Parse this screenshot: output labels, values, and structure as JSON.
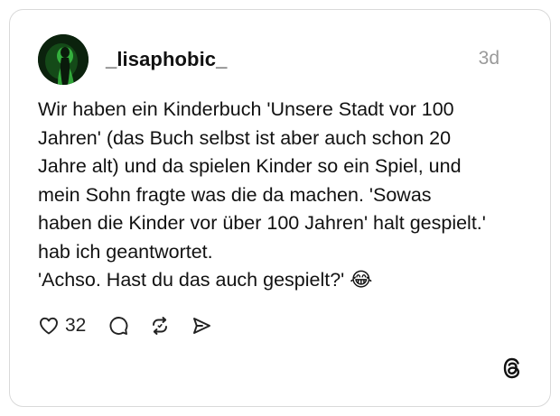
{
  "post": {
    "author": {
      "username": "_lisaphobic_",
      "avatar_icon": "user-avatar-green-silhouette"
    },
    "timestamp": "3d",
    "text_lines": [
      "Wir haben ein Kinderbuch 'Unsere Stadt vor 100",
      "Jahren' (das Buch selbst ist aber auch schon 20",
      "Jahre alt) und da spielen Kinder so ein Spiel, und",
      "mein Sohn fragte was die da machen. 'Sowas",
      "haben die Kinder vor über 100 Jahren' halt gespielt.'",
      "hab ich geantwortet.",
      "'Achso. Hast du das auch gespielt?' 😂"
    ],
    "actions": {
      "like_icon": "heart-icon",
      "like_count": "32",
      "comment_icon": "comment-bubble-icon",
      "repost_icon": "repost-icon",
      "share_icon": "send-icon"
    }
  },
  "branding": {
    "logo_icon": "threads-logo-icon"
  },
  "colors": {
    "text": "#111111",
    "muted": "#9a9a9a",
    "border": "#d9d9d9",
    "avatar_green": "#2fbf3a"
  }
}
